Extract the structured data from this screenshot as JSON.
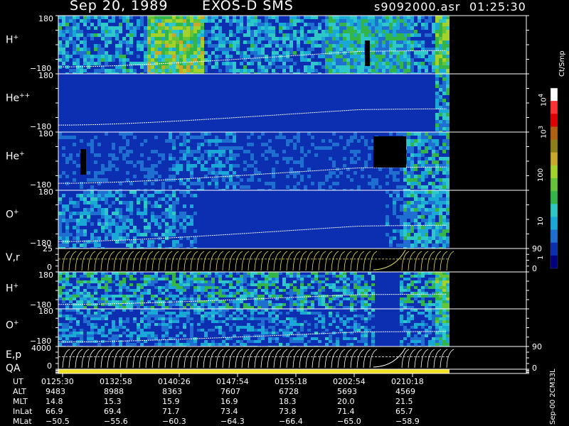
{
  "header": {
    "date": "Sep 20, 1989",
    "instrument": "EXOS-D SMS",
    "file": "s9092000.asr",
    "time": "01:25:30"
  },
  "panels": [
    {
      "id": "hplus1",
      "label": "H",
      "sup": "+",
      "ytop": "180",
      "ybot": "−180"
    },
    {
      "id": "hepp",
      "label": "He",
      "sup": "++",
      "ytop": "180",
      "ybot": "−180"
    },
    {
      "id": "heplus",
      "label": "He",
      "sup": "+",
      "ytop": "180",
      "ybot": "−180"
    },
    {
      "id": "oplus1",
      "label": "O",
      "sup": "+",
      "ytop": "180",
      "ybot": "−180"
    },
    {
      "id": "vr",
      "label": "V,r",
      "sup": "",
      "ytop": "25",
      "ybot": "0",
      "rtop": "90",
      "rbot": "0"
    },
    {
      "id": "hplus2",
      "label": "H",
      "sup": "+",
      "ytop": "180",
      "ybot": "−180"
    },
    {
      "id": "oplus2",
      "label": "O",
      "sup": "+",
      "ytop": "180",
      "ybot": "−180"
    },
    {
      "id": "ep",
      "label": "E,p",
      "sup": "",
      "ytop": "4000",
      "ybot": "0",
      "rtop": "90",
      "rbot": "0"
    },
    {
      "id": "qa",
      "label": "QA",
      "sup": ""
    }
  ],
  "colorbar": {
    "unit": "Ct/Smp",
    "labels": [
      {
        "base": "10",
        "sup": "4"
      },
      {
        "base": "10",
        "sup": "3"
      },
      {
        "base": "100",
        "sup": ""
      },
      {
        "base": "10",
        "sup": ""
      },
      {
        "base": "1",
        "sup": ""
      }
    ],
    "colors": [
      "#000080",
      "#0b2fb0",
      "#1f6fd0",
      "#1aa9d6",
      "#2fc8c8",
      "#33b54a",
      "#66c43a",
      "#a3d22c",
      "#c9a82c",
      "#8f7f1a",
      "#b06010",
      "#e00000",
      "#ff3030",
      "#ffffff"
    ]
  },
  "footer": {
    "row_labels": [
      "UT",
      "ALT",
      "MLT",
      "InLat",
      "MLat"
    ],
    "columns": [
      {
        "UT": "0125:30",
        "ALT": "9483",
        "MLT": "14.8",
        "InLat": "66.9",
        "MLat": "−50.5"
      },
      {
        "UT": "0132:58",
        "ALT": "8988",
        "MLT": "15.3",
        "InLat": "69.4",
        "MLat": "−55.6"
      },
      {
        "UT": "0140:26",
        "ALT": "8363",
        "MLT": "15.9",
        "InLat": "71.7",
        "MLat": "−60.3"
      },
      {
        "UT": "0147:54",
        "ALT": "7607",
        "MLT": "16.9",
        "InLat": "73.4",
        "MLat": "−64.3"
      },
      {
        "UT": "0155:18",
        "ALT": "6728",
        "MLT": "18.3",
        "InLat": "73.8",
        "MLat": "−66.4"
      },
      {
        "UT": "0202:54",
        "ALT": "5693",
        "MLT": "20.0",
        "InLat": "71.4",
        "MLat": "−65.0"
      },
      {
        "UT": "0210:18",
        "ALT": "4569",
        "MLT": "21.5",
        "InLat": "65.7",
        "MLat": "−58.9"
      }
    ],
    "stamp": "Sep-00 2CM33L"
  },
  "chart_data": {
    "type": "heatmap",
    "x": [
      "0125:30",
      "0132:58",
      "0140:26",
      "0147:54",
      "0155:18",
      "0202:54",
      "0210:18"
    ],
    "series": [
      {
        "name": "H+",
        "ylim": [
          -180,
          180
        ]
      },
      {
        "name": "He++",
        "ylim": [
          -180,
          180
        ]
      },
      {
        "name": "He+",
        "ylim": [
          -180,
          180
        ]
      },
      {
        "name": "O+",
        "ylim": [
          -180,
          180
        ]
      },
      {
        "name": "V,r",
        "ylim": [
          0,
          25
        ],
        "ylim_right": [
          0,
          90
        ]
      },
      {
        "name": "H+",
        "ylim": [
          -180,
          180
        ]
      },
      {
        "name": "O+",
        "ylim": [
          -180,
          180
        ]
      },
      {
        "name": "E,p",
        "ylim": [
          0,
          4000
        ],
        "ylim_right": [
          0,
          90
        ]
      },
      {
        "name": "QA"
      }
    ],
    "colorbar_unit": "Ct/Smp",
    "colorbar_ticks": [
      "1",
      "10",
      "100",
      "10^3",
      "10^4"
    ]
  }
}
